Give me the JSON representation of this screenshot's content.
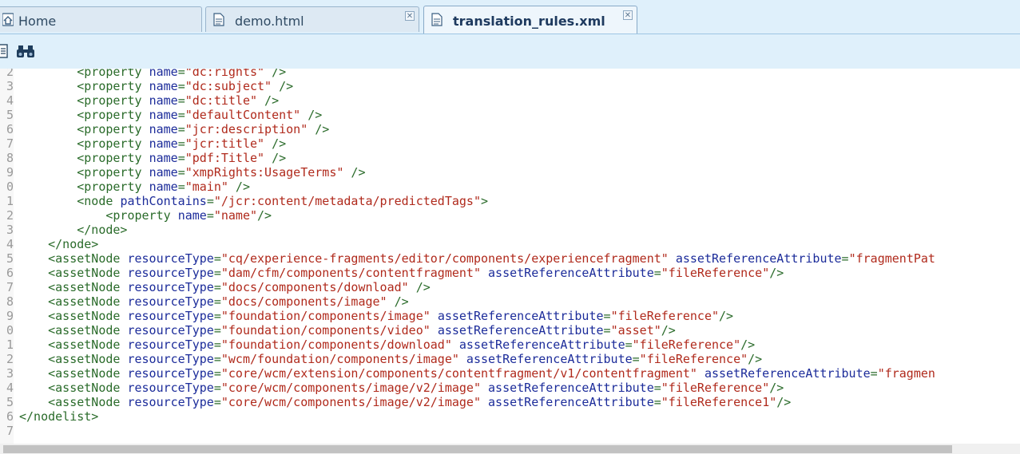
{
  "tabs": [
    {
      "label": "Home",
      "icon": "home-icon",
      "closable": false
    },
    {
      "label": "demo.html",
      "icon": "document-icon",
      "closable": true
    },
    {
      "label": "translation_rules.xml",
      "icon": "document-icon",
      "closable": true,
      "active": true
    }
  ],
  "toolbar": {
    "icons": [
      "page-icon",
      "binoculars-icon"
    ]
  },
  "editor": {
    "lines": [
      {
        "num": "2",
        "indent": "        ",
        "parts": [
          [
            "tag",
            "<property "
          ],
          [
            "attr",
            "name"
          ],
          [
            "tag",
            "="
          ],
          [
            "val",
            "\"dc:rights\""
          ],
          [
            "tag",
            " />"
          ]
        ]
      },
      {
        "num": "3",
        "indent": "        ",
        "parts": [
          [
            "tag",
            "<property "
          ],
          [
            "attr",
            "name"
          ],
          [
            "tag",
            "="
          ],
          [
            "val",
            "\"dc:subject\""
          ],
          [
            "tag",
            " />"
          ]
        ]
      },
      {
        "num": "4",
        "indent": "        ",
        "parts": [
          [
            "tag",
            "<property "
          ],
          [
            "attr",
            "name"
          ],
          [
            "tag",
            "="
          ],
          [
            "val",
            "\"dc:title\""
          ],
          [
            "tag",
            " />"
          ]
        ]
      },
      {
        "num": "5",
        "indent": "        ",
        "parts": [
          [
            "tag",
            "<property "
          ],
          [
            "attr",
            "name"
          ],
          [
            "tag",
            "="
          ],
          [
            "val",
            "\"defaultContent\""
          ],
          [
            "tag",
            " />"
          ]
        ]
      },
      {
        "num": "6",
        "indent": "        ",
        "parts": [
          [
            "tag",
            "<property "
          ],
          [
            "attr",
            "name"
          ],
          [
            "tag",
            "="
          ],
          [
            "val",
            "\"jcr:description\""
          ],
          [
            "tag",
            " />"
          ]
        ]
      },
      {
        "num": "7",
        "indent": "        ",
        "parts": [
          [
            "tag",
            "<property "
          ],
          [
            "attr",
            "name"
          ],
          [
            "tag",
            "="
          ],
          [
            "val",
            "\"jcr:title\""
          ],
          [
            "tag",
            " />"
          ]
        ]
      },
      {
        "num": "8",
        "indent": "        ",
        "parts": [
          [
            "tag",
            "<property "
          ],
          [
            "attr",
            "name"
          ],
          [
            "tag",
            "="
          ],
          [
            "val",
            "\"pdf:Title\""
          ],
          [
            "tag",
            " />"
          ]
        ]
      },
      {
        "num": "9",
        "indent": "        ",
        "parts": [
          [
            "tag",
            "<property "
          ],
          [
            "attr",
            "name"
          ],
          [
            "tag",
            "="
          ],
          [
            "val",
            "\"xmpRights:UsageTerms\""
          ],
          [
            "tag",
            " />"
          ]
        ]
      },
      {
        "num": "0",
        "indent": "        ",
        "parts": [
          [
            "tag",
            "<property "
          ],
          [
            "attr",
            "name"
          ],
          [
            "tag",
            "="
          ],
          [
            "val",
            "\"main\""
          ],
          [
            "tag",
            " />"
          ]
        ]
      },
      {
        "num": "1",
        "indent": "        ",
        "parts": [
          [
            "tag",
            "<node "
          ],
          [
            "attr",
            "pathContains"
          ],
          [
            "tag",
            "="
          ],
          [
            "val",
            "\"/jcr:content/metadata/predictedTags\""
          ],
          [
            "tag",
            ">"
          ]
        ]
      },
      {
        "num": "2",
        "indent": "            ",
        "parts": [
          [
            "tag",
            "<property "
          ],
          [
            "attr",
            "name"
          ],
          [
            "tag",
            "="
          ],
          [
            "val",
            "\"name\""
          ],
          [
            "tag",
            "/>"
          ]
        ]
      },
      {
        "num": "3",
        "indent": "        ",
        "parts": [
          [
            "tag",
            "</node>"
          ]
        ]
      },
      {
        "num": "4",
        "indent": "    ",
        "parts": [
          [
            "tag",
            "</node>"
          ]
        ]
      },
      {
        "num": "5",
        "indent": "    ",
        "parts": [
          [
            "tag",
            "<assetNode "
          ],
          [
            "attr",
            "resourceType"
          ],
          [
            "tag",
            "="
          ],
          [
            "val",
            "\"cq/experience-fragments/editor/components/experiencefragment\""
          ],
          [
            "tag",
            " "
          ],
          [
            "attr",
            "assetReferenceAttribute"
          ],
          [
            "tag",
            "="
          ],
          [
            "val",
            "\"fragmentPat"
          ]
        ]
      },
      {
        "num": "6",
        "indent": "    ",
        "parts": [
          [
            "tag",
            "<assetNode "
          ],
          [
            "attr",
            "resourceType"
          ],
          [
            "tag",
            "="
          ],
          [
            "val",
            "\"dam/cfm/components/contentfragment\""
          ],
          [
            "tag",
            " "
          ],
          [
            "attr",
            "assetReferenceAttribute"
          ],
          [
            "tag",
            "="
          ],
          [
            "val",
            "\"fileReference\""
          ],
          [
            "tag",
            "/>"
          ]
        ]
      },
      {
        "num": "7",
        "indent": "    ",
        "parts": [
          [
            "tag",
            "<assetNode "
          ],
          [
            "attr",
            "resourceType"
          ],
          [
            "tag",
            "="
          ],
          [
            "val",
            "\"docs/components/download\""
          ],
          [
            "tag",
            " />"
          ]
        ]
      },
      {
        "num": "8",
        "indent": "    ",
        "parts": [
          [
            "tag",
            "<assetNode "
          ],
          [
            "attr",
            "resourceType"
          ],
          [
            "tag",
            "="
          ],
          [
            "val",
            "\"docs/components/image\""
          ],
          [
            "tag",
            " />"
          ]
        ]
      },
      {
        "num": "9",
        "indent": "    ",
        "parts": [
          [
            "tag",
            "<assetNode "
          ],
          [
            "attr",
            "resourceType"
          ],
          [
            "tag",
            "="
          ],
          [
            "val",
            "\"foundation/components/image\""
          ],
          [
            "tag",
            " "
          ],
          [
            "attr",
            "assetReferenceAttribute"
          ],
          [
            "tag",
            "="
          ],
          [
            "val",
            "\"fileReference\""
          ],
          [
            "tag",
            "/>"
          ]
        ]
      },
      {
        "num": "0",
        "indent": "    ",
        "parts": [
          [
            "tag",
            "<assetNode "
          ],
          [
            "attr",
            "resourceType"
          ],
          [
            "tag",
            "="
          ],
          [
            "val",
            "\"foundation/components/video\""
          ],
          [
            "tag",
            " "
          ],
          [
            "attr",
            "assetReferenceAttribute"
          ],
          [
            "tag",
            "="
          ],
          [
            "val",
            "\"asset\""
          ],
          [
            "tag",
            "/>"
          ]
        ]
      },
      {
        "num": "1",
        "indent": "    ",
        "parts": [
          [
            "tag",
            "<assetNode "
          ],
          [
            "attr",
            "resourceType"
          ],
          [
            "tag",
            "="
          ],
          [
            "val",
            "\"foundation/components/download\""
          ],
          [
            "tag",
            " "
          ],
          [
            "attr",
            "assetReferenceAttribute"
          ],
          [
            "tag",
            "="
          ],
          [
            "val",
            "\"fileReference\""
          ],
          [
            "tag",
            "/>"
          ]
        ]
      },
      {
        "num": "2",
        "indent": "    ",
        "parts": [
          [
            "tag",
            "<assetNode "
          ],
          [
            "attr",
            "resourceType"
          ],
          [
            "tag",
            "="
          ],
          [
            "val",
            "\"wcm/foundation/components/image\""
          ],
          [
            "tag",
            " "
          ],
          [
            "attr",
            "assetReferenceAttribute"
          ],
          [
            "tag",
            "="
          ],
          [
            "val",
            "\"fileReference\""
          ],
          [
            "tag",
            "/>"
          ]
        ]
      },
      {
        "num": "3",
        "indent": "    ",
        "parts": [
          [
            "tag",
            "<assetNode "
          ],
          [
            "attr",
            "resourceType"
          ],
          [
            "tag",
            "="
          ],
          [
            "val",
            "\"core/wcm/extension/components/contentfragment/v1/contentfragment\""
          ],
          [
            "tag",
            " "
          ],
          [
            "attr",
            "assetReferenceAttribute"
          ],
          [
            "tag",
            "="
          ],
          [
            "val",
            "\"fragmen"
          ]
        ]
      },
      {
        "num": "4",
        "indent": "    ",
        "parts": [
          [
            "tag",
            "<assetNode "
          ],
          [
            "attr",
            "resourceType"
          ],
          [
            "tag",
            "="
          ],
          [
            "val",
            "\"core/wcm/components/image/v2/image\""
          ],
          [
            "tag",
            " "
          ],
          [
            "attr",
            "assetReferenceAttribute"
          ],
          [
            "tag",
            "="
          ],
          [
            "val",
            "\"fileReference\""
          ],
          [
            "tag",
            "/>"
          ]
        ]
      },
      {
        "num": "5",
        "indent": "    ",
        "parts": [
          [
            "tag",
            "<assetNode "
          ],
          [
            "attr",
            "resourceType"
          ],
          [
            "tag",
            "="
          ],
          [
            "val",
            "\"core/wcm/components/image/v2/image\""
          ],
          [
            "tag",
            " "
          ],
          [
            "attr",
            "assetReferenceAttribute"
          ],
          [
            "tag",
            "="
          ],
          [
            "val",
            "\"fileReference1\""
          ],
          [
            "tag",
            "/>"
          ]
        ]
      },
      {
        "num": "6",
        "indent": "",
        "parts": [
          [
            "tag",
            "</nodelist>"
          ]
        ]
      },
      {
        "num": "7",
        "indent": "",
        "parts": []
      }
    ]
  },
  "colors": {
    "tag": "#2a6b2a",
    "attr": "#1c2c9a",
    "val": "#b02a1c",
    "tabbar": "#dff0fb"
  }
}
